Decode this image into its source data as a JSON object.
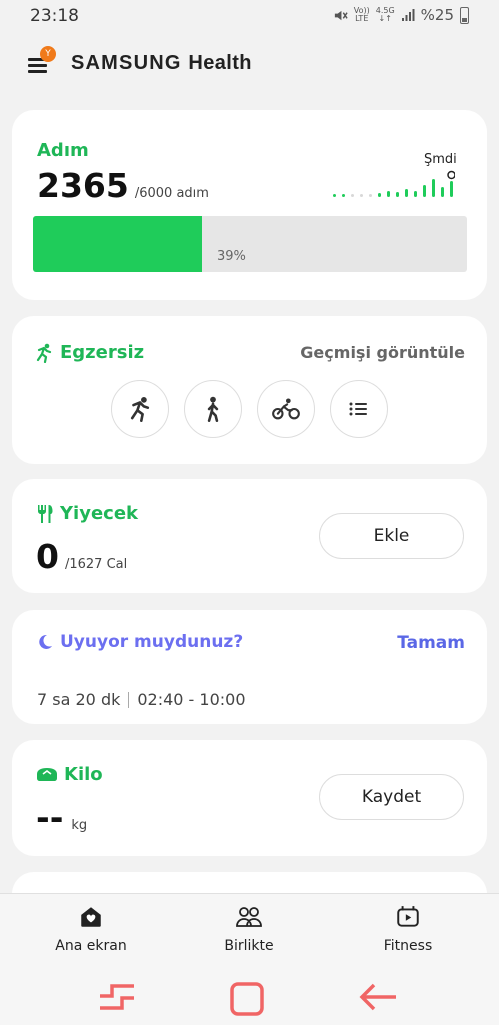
{
  "status": {
    "time": "23:18",
    "volte_top": "Vo))",
    "volte_bottom": "LTE",
    "net_top": "4.5G",
    "net_bottom": "↓↑",
    "battery": "%25"
  },
  "header": {
    "brand": "SAMSUNG",
    "brand_suffix": "Health",
    "menu_badge": "Y"
  },
  "steps": {
    "title": "Adım",
    "count": "2365",
    "goal": "/6000 adım",
    "now_label": "Şmdi",
    "progress_percent": 39,
    "progress_label": "39%",
    "accent": "#1fcc5a"
  },
  "exercise": {
    "title": "Egzersiz",
    "history_link": "Geçmişi görüntüle"
  },
  "food": {
    "title": "Yiyecek",
    "value": "0",
    "goal": "/1627 Cal",
    "add_label": "Ekle"
  },
  "sleep": {
    "title": "Uyuyor muydunuz?",
    "confirm_label": "Tamam",
    "duration": "7 sa 20 dk",
    "range": "02:40 - 10:00",
    "accent": "#5a67e6"
  },
  "weight": {
    "title": "Kilo",
    "value": "--",
    "unit": "kg",
    "save_label": "Kaydet"
  },
  "bottom_nav": {
    "home": "Ana ekran",
    "together": "Birlikte",
    "fitness": "Fitness"
  }
}
